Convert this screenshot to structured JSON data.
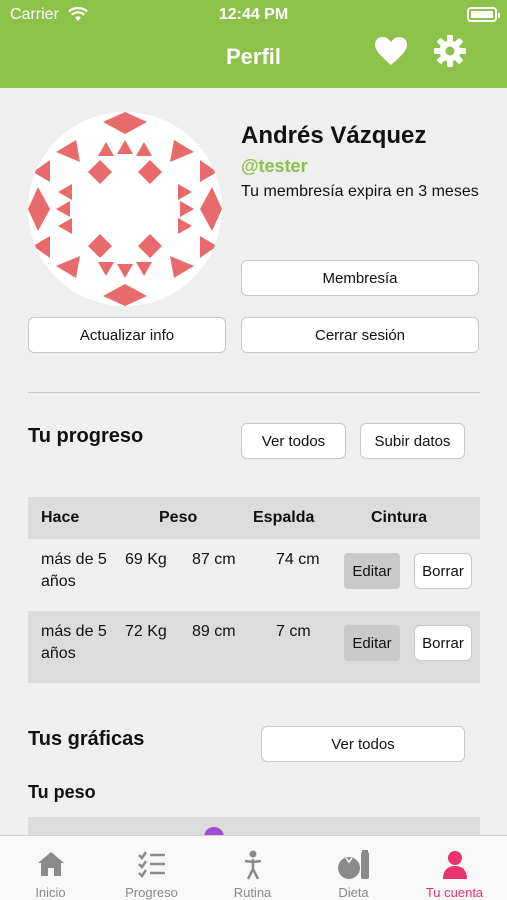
{
  "status_bar": {
    "carrier": "Carrier",
    "time": "12:44 PM"
  },
  "header": {
    "title": "Perfil",
    "icons": [
      "heart-icon",
      "gear-icon"
    ]
  },
  "profile": {
    "name": "Andrés Vázquez",
    "handle": "@tester",
    "membership_text": " Tu membresía expira en 3 meses",
    "membership_button": "Membresía",
    "update_button": "Actualizar info",
    "logout_button": "Cerrar sesión"
  },
  "progress": {
    "title": "Tu progreso",
    "view_all": "Ver todos",
    "upload": "Subir datos",
    "columns": [
      "Hace",
      "Peso",
      "Espalda",
      "Cintura"
    ],
    "rows": [
      {
        "ago": "más de 5 años",
        "weight": "69 Kg",
        "back": "87 cm",
        "waist": "74 cm",
        "edit": "Editar",
        "delete": "Borrar"
      },
      {
        "ago": "más de 5 años",
        "weight": "72 Kg",
        "back": "89 cm",
        "waist": "7 cm",
        "edit": "Editar",
        "delete": "Borrar"
      }
    ]
  },
  "charts": {
    "title": "Tus gráficas",
    "view_all": "Ver todos",
    "weight_title": "Tu peso"
  },
  "tabbar": {
    "items": [
      {
        "label": "Inicio",
        "icon": "home-icon"
      },
      {
        "label": "Progreso",
        "icon": "checklist-icon"
      },
      {
        "label": "Rutina",
        "icon": "figure-icon"
      },
      {
        "label": "Dieta",
        "icon": "food-icon"
      },
      {
        "label": "Tu cuenta",
        "icon": "user-icon"
      }
    ]
  },
  "colors": {
    "brand": "#8cc24a",
    "accent": "#e8336e",
    "avatar_pattern": "#e86a6c",
    "chart_point": "#a34bd6"
  }
}
